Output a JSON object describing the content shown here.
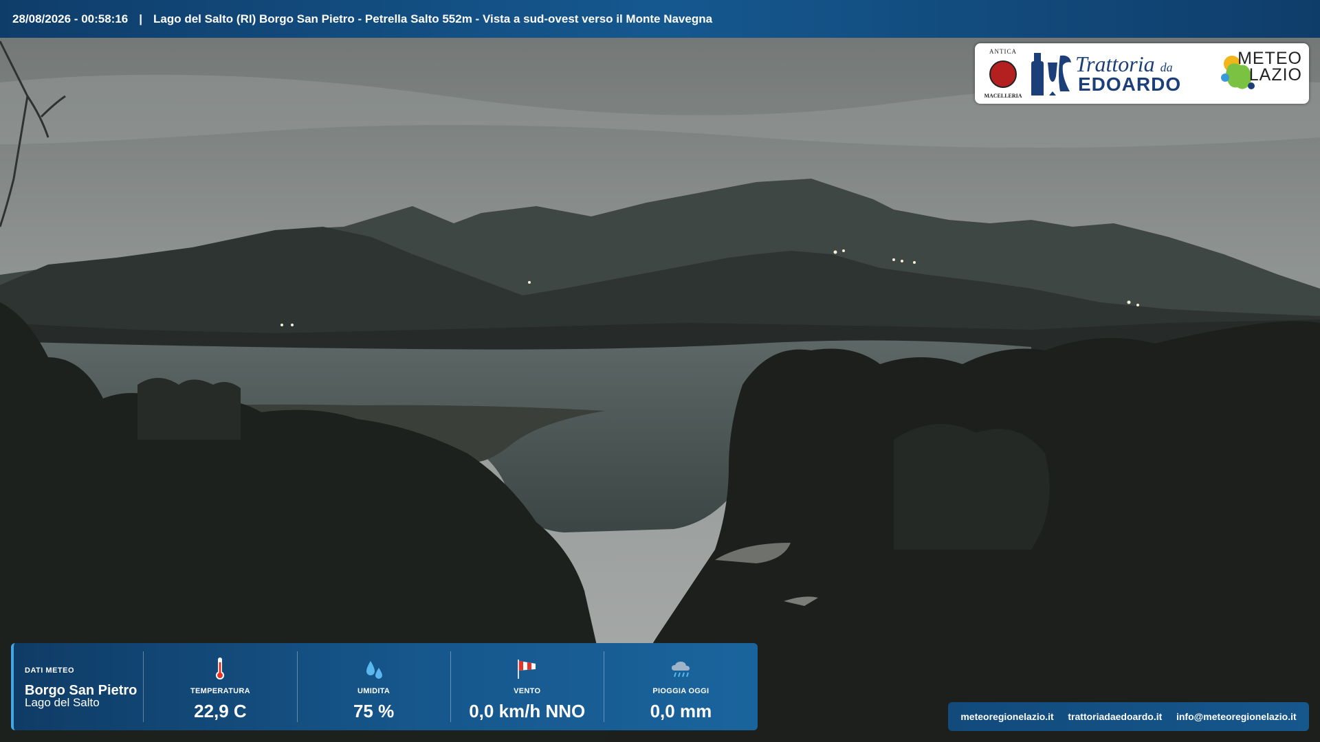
{
  "header": {
    "datetime": "28/08/2026 - 00:58:16",
    "separator": "|",
    "title": "Lago del Salto (RI) Borgo San Pietro - Petrella Salto 552m - Vista a sud-ovest verso il Monte Navegna"
  },
  "sponsor": {
    "badge_top": "ANTICA",
    "badge_bottom": "MACELLERIA",
    "trattoria_script": "Trattoria",
    "trattoria_da": "da",
    "trattoria_name": "EDOARDO",
    "meteo_line1": "METEO",
    "meteo_line2": "LAZIO"
  },
  "weather": {
    "section_label": "DATI METEO",
    "location_main": "Borgo San Pietro",
    "location_sub": "Lago del Salto",
    "metrics": [
      {
        "icon": "thermometer-icon",
        "label": "TEMPERATURA",
        "value": "22,9  C"
      },
      {
        "icon": "water-drops-icon",
        "label": "UMIDITA",
        "value": "75 %"
      },
      {
        "icon": "windsock-icon",
        "label": "VENTO",
        "value": "0,0 km/h NNO"
      },
      {
        "icon": "rain-cloud-icon",
        "label": "PIOGGIA OGGI",
        "value": "0,0 mm"
      }
    ]
  },
  "links": [
    "meteoregionelazio.it",
    "trattoriadaedoardo.it",
    "info@meteoregionelazio.it"
  ],
  "colors": {
    "bar_blue": "#15588f",
    "accent": "#43a6e6",
    "sky": "#8f9391",
    "lake": "#4a5553"
  }
}
